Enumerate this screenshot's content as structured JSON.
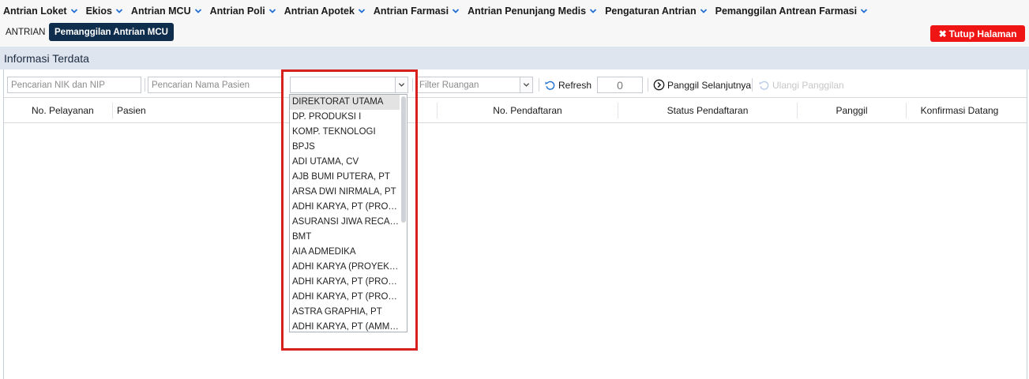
{
  "nav": {
    "items": [
      {
        "label": "Antrian Loket"
      },
      {
        "label": "Ekios"
      },
      {
        "label": "Antrian MCU"
      },
      {
        "label": "Antrian Poli"
      },
      {
        "label": "Antrian Apotek"
      },
      {
        "label": "Antrian Farmasi"
      },
      {
        "label": "Antrian Penunjang Medis"
      },
      {
        "label": "Pengaturan Antrian"
      },
      {
        "label": "Pemanggilan Antrean Farmasi"
      }
    ]
  },
  "tabs": {
    "first": "ANTRIAN",
    "active": "Pemanggilan Antrian MCU"
  },
  "close_button": "Tutup Halaman",
  "panel_title": "Informasi Terdata",
  "toolbar": {
    "nik_placeholder": "Pencarian NIK dan NIP",
    "name_placeholder": "Pencarian Nama Pasien",
    "company_value": "",
    "room_placeholder": "Filter Ruangan",
    "refresh_label": "Refresh",
    "counter_value": "0",
    "next_label": "Panggil Selanjutnya",
    "recall_label": "Ulangi Panggilan"
  },
  "columns": [
    "No. Pelayanan",
    "Pasien",
    "No. Pendaftaran",
    "Status Pendaftaran",
    "Panggil",
    "Konfirmasi Datang"
  ],
  "dropdown": {
    "selected_index": 0,
    "options": [
      "DIREKTORAT UTAMA",
      "DP. PRODUKSI I",
      "KOMP. TEKNOLOGI",
      "BPJS",
      "ADI UTAMA, CV",
      "AJB BUMI PUTERA, PT",
      "ARSA DWI NIRMALA, PT",
      "ADHI KARYA, PT (PROY…",
      "ASURANSI JIWA RECAP…",
      "BMT",
      "AIA ADMEDIKA",
      "ADHI KARYA (PROYEK R…",
      "ADHI KARYA, PT (PROY…",
      "ADHI KARYA, PT (PROY…",
      "ASTRA GRAPHIA, PT",
      "ADHI KARYA, PT (AMM…"
    ]
  },
  "colors": {
    "accent_dark": "#0f2d4d",
    "danger": "#f01515",
    "highlight": "#d8201c",
    "header_bg": "#dfe5ee"
  }
}
